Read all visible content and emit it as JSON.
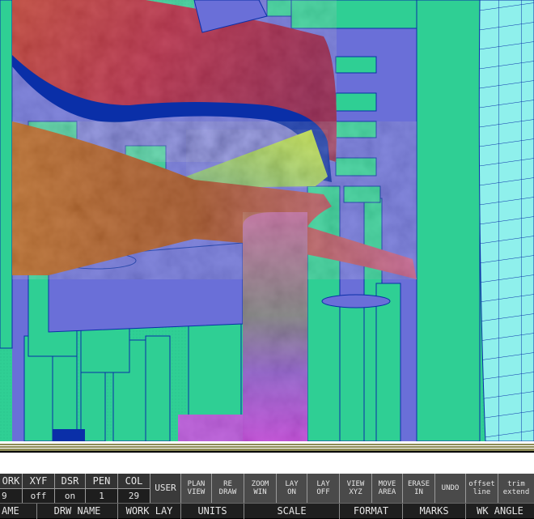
{
  "colors": {
    "teal": "#2fcf94",
    "periwinkle": "#6a6fd8",
    "navy": "#0a2fa8",
    "cyan_grid": "#8ff0ec",
    "status_bg": "#333333",
    "separator_olive": "#8c8a55"
  },
  "status": [
    {
      "label": "ORK",
      "value": "9"
    },
    {
      "label": "XYF",
      "value": "off"
    },
    {
      "label": "DSR",
      "value": "on"
    },
    {
      "label": "PEN",
      "value": "1"
    },
    {
      "label": "COL",
      "value": "29"
    }
  ],
  "buttons": [
    {
      "id": "user",
      "label": "USER"
    },
    {
      "id": "plan-view",
      "label": "PLAN\nVIEW"
    },
    {
      "id": "redraw",
      "label": "RE\nDRAW"
    },
    {
      "id": "zoom-win",
      "label": "ZOOM\nWIN"
    },
    {
      "id": "lay-on",
      "label": "LAY\nON"
    },
    {
      "id": "lay-off",
      "label": "LAY\nOFF"
    },
    {
      "id": "view-xyz",
      "label": "VIEW\nXYZ"
    },
    {
      "id": "move-area",
      "label": "MOVE\nAREA"
    },
    {
      "id": "erase-in",
      "label": "ERASE\nIN"
    },
    {
      "id": "undo",
      "label": "UNDO"
    },
    {
      "id": "offset-line",
      "label": "offset\nline"
    },
    {
      "id": "trim-extend",
      "label": "trim\nextend"
    }
  ],
  "labels": [
    "AME",
    "DRW NAME",
    "WORK LAY",
    "UNITS",
    "SCALE",
    "FORMAT",
    "MARKS",
    "WK ANGLE"
  ]
}
